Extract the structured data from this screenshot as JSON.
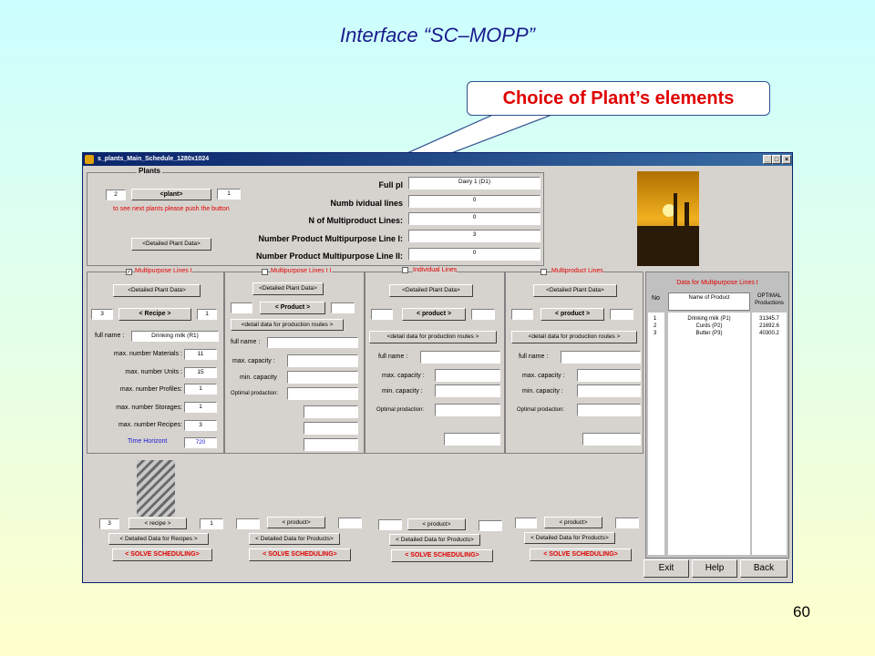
{
  "slide": {
    "title": "Interface “SC–MOPP”",
    "callout": "Choice of Plant’s elements",
    "page_number": "60"
  },
  "window": {
    "title": "s_plants_Main_Schedule_1280x1024",
    "min_btn": "_",
    "max_btn": "□",
    "close_btn": "×"
  },
  "plants": {
    "title": "Plants",
    "plant_number": "2",
    "plant_btn": "<plant>",
    "plant_count": "1",
    "hint": "to see next plants please push the button",
    "detailed_btn": "<Detailed Plant Data>",
    "full_label": "Full pl",
    "full_value": "Dairy 1 (D1)",
    "indiv_label": "Numb        ividual lines",
    "indiv_value": "0",
    "multiproduct_label": "N        of Multiproduct  Lines:",
    "multiproduct_value": "0",
    "mp1_label": "Number Product Multipurpose Line  I:",
    "mp1_value": "3",
    "mp2_label": "Number Product Multipurpose Line II:",
    "mp2_value": "0"
  },
  "line1": {
    "title": "Multipurpose Lines I",
    "checked": "✓",
    "detailed_btn": "<Detailed Plant Data>",
    "recipe_num": "3",
    "recipe_btn": "< Recipe >",
    "recipe_count": "1",
    "full_name_label": "full name :",
    "full_name": "Drinking milk (R1)",
    "materials_label": "max. number Materials :",
    "materials": "11",
    "units_label": "max. number Units :",
    "units": "15",
    "profiles_label": "max. number Profiles:",
    "profiles": "1",
    "storages_label": "max. number Storages:",
    "storages": "1",
    "recipes_label": "max. number Recipes:",
    "recipes": "3",
    "horizon_label": "Time Horizont",
    "horizon": "720"
  },
  "line2": {
    "title": "Multipurpose Lines I I",
    "detailed_btn": "<Detailed Plant Data>",
    "product_btn": "< Product >",
    "routes_btn": "<detail data for production routes >",
    "full_name_label": "full name :",
    "max_cap_label": "max. capacity :",
    "min_cap_label": "min. capacity",
    "optimal_label": "Optimal prodaction:"
  },
  "line3": {
    "title": "Individual Lines",
    "detailed_btn": "<Detailed Plant Data>",
    "product_btn": "< product >",
    "routes_btn": "<detail data for production routes >",
    "full_name_label": "full name :",
    "max_cap_label": "max. capacity  :",
    "min_cap_label": "min. capacity :",
    "optimal_label": "Optimal prodaction:"
  },
  "line4": {
    "title": "Multiproduct Lines",
    "detailed_btn": "<Detailed Plant Data>",
    "product_btn": "< product >",
    "routes_btn": "<detail data for production routes >",
    "full_name_label": "full name :",
    "max_cap_label": "max. capacity  :",
    "min_cap_label": "min. capacity :",
    "optimal_label": "Optimal prodaction:"
  },
  "data_panel": {
    "title": "Data for Multipurpose Lines I",
    "col_no": "No",
    "col_name": "Name of Product",
    "col_opt": "OPTIMAL Productions",
    "rows": [
      {
        "no": "1",
        "name": "Drinking milk (P1)",
        "opt": "31345.7"
      },
      {
        "no": "2",
        "name": "Curds (P2)",
        "opt": "21692.6"
      },
      {
        "no": "3",
        "name": "Butter (P3)",
        "opt": "40300.2"
      }
    ]
  },
  "bottom": {
    "b1_num": "3",
    "b1_btn": "< recipe >",
    "b1_count": "1",
    "b1_detail": "< Detailed Data for Recipes >",
    "b2_btn": "< product>",
    "b2_detail": "< Detailed Data for Products>",
    "b3_btn": "< product>",
    "b3_detail": "< Detailed Data for Products>",
    "b4_btn": "< product>",
    "b4_detail": "< Detailed Data for Products>",
    "solve": "< SOLVE SCHEDULING>"
  },
  "actions": {
    "exit": "Exit",
    "help": "Help",
    "back": "Back"
  }
}
